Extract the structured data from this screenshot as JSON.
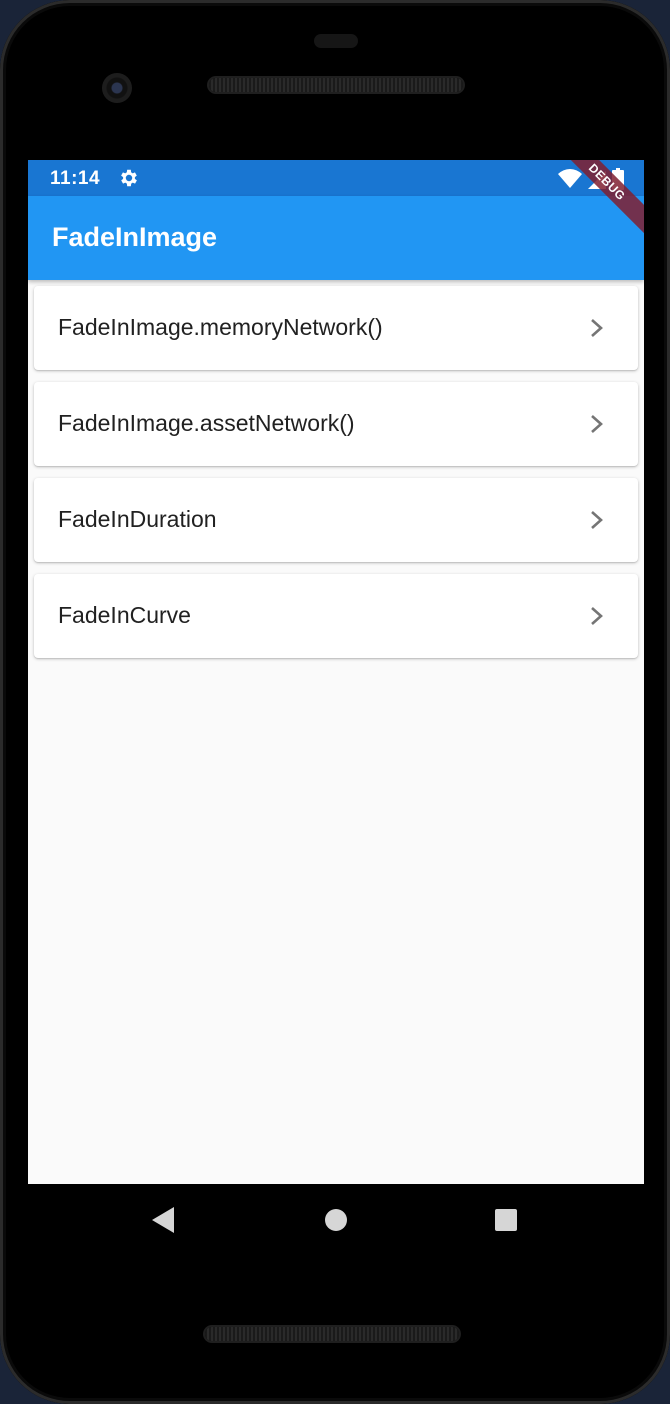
{
  "status_bar": {
    "time": "11:14",
    "background": "#1976d2",
    "icons": [
      "settings-gear-icon",
      "wifi-icon",
      "cell-signal-icon",
      "battery-icon"
    ]
  },
  "app_bar": {
    "title": "FadeInImage",
    "background": "#2196f3"
  },
  "debug_banner": {
    "label": "DEBUG"
  },
  "list": {
    "items": [
      {
        "label": "FadeInImage.memoryNetwork()"
      },
      {
        "label": "FadeInImage.assetNetwork()"
      },
      {
        "label": "FadeInDuration"
      },
      {
        "label": "FadeInCurve"
      }
    ]
  },
  "nav_bar": {
    "icons": [
      "back-triangle-icon",
      "home-circle-icon",
      "recents-square-icon"
    ]
  }
}
